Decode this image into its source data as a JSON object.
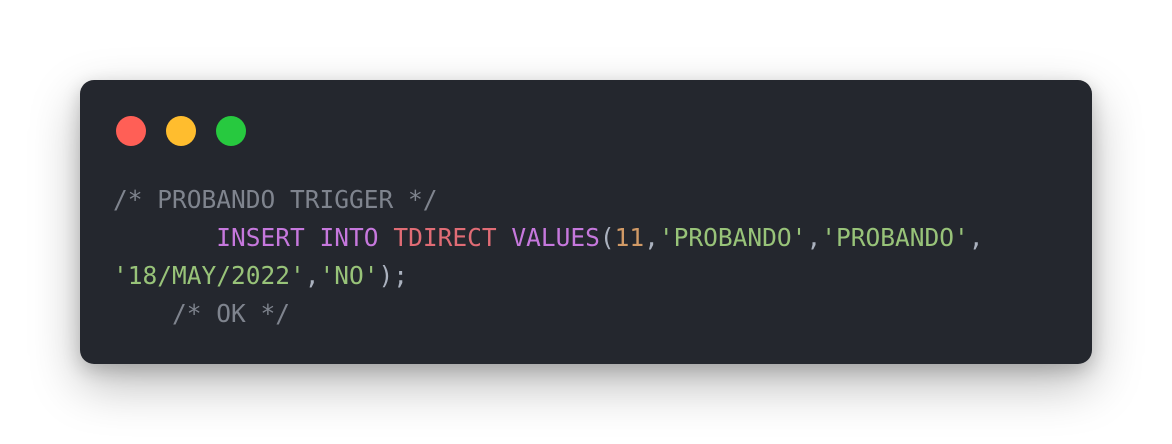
{
  "window": {
    "controls": [
      {
        "name": "close",
        "color": "#ff5f56"
      },
      {
        "name": "minimize",
        "color": "#ffbd2e"
      },
      {
        "name": "maximize",
        "color": "#27c93f"
      }
    ]
  },
  "code": {
    "line1": {
      "comment": "/* PROBANDO TRIGGER */"
    },
    "line2": {
      "indent": "       ",
      "kw_insert": "INSERT",
      "kw_into": "INTO",
      "table": "TDIRECT",
      "kw_values": "VALUES",
      "open_paren": "(",
      "num": "11",
      "comma1": ",",
      "str1": "'PROBANDO'",
      "comma2": ",",
      "str2": "'PROBANDO'",
      "comma3": ","
    },
    "line3": {
      "str_date": "'18/MAY/2022'",
      "comma": ",",
      "str_no": "'NO'",
      "close": ");"
    },
    "line4": {
      "indent": "    ",
      "comment": "/* OK */"
    }
  }
}
